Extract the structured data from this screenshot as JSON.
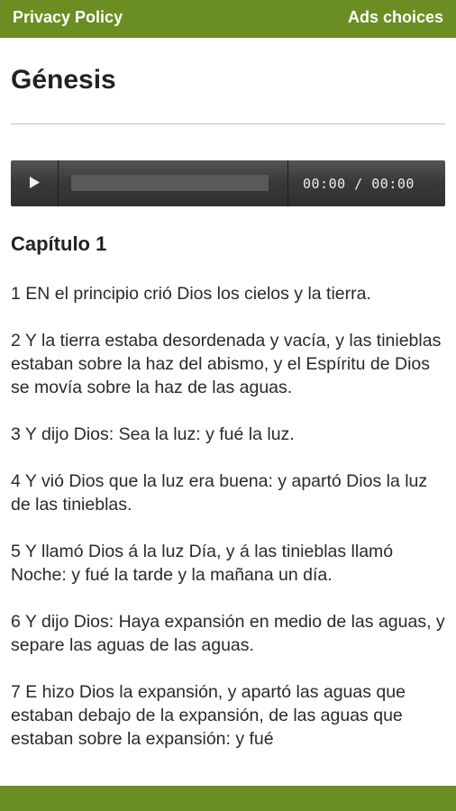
{
  "topbar": {
    "left_link": "Privacy Policy",
    "right_link": "Ads choices"
  },
  "book": {
    "title": "Génesis"
  },
  "player": {
    "time": "00:00 / 00:00"
  },
  "chapter": {
    "title": "Capítulo 1"
  },
  "verses": [
    "1 EN el principio crió Dios los cielos y la tierra.",
    "2 Y la tierra estaba desordenada y vacía, y las tinieblas estaban sobre la haz del abismo, y el Espíritu de Dios se movía sobre la haz de las aguas.",
    "3 Y dijo Dios: Sea la luz: y fué la luz.",
    "4 Y vió Dios que la luz era buena: y apartó Dios la luz de las tinieblas.",
    "5 Y llamó Dios á la luz Día, y á las tinieblas llamó Noche: y fué la tarde y la mañana un día.",
    "6 Y dijo Dios: Haya expansión en medio de las aguas, y separe las aguas de las aguas.",
    "7 E hizo Dios la expansión, y apartó las aguas que estaban debajo de la expansión, de las aguas que estaban sobre la expansión: y fué"
  ],
  "colors": {
    "accent": "#6b8e23",
    "player_bg": "#3a3a3a"
  },
  "icons": {
    "play": "play-icon"
  }
}
